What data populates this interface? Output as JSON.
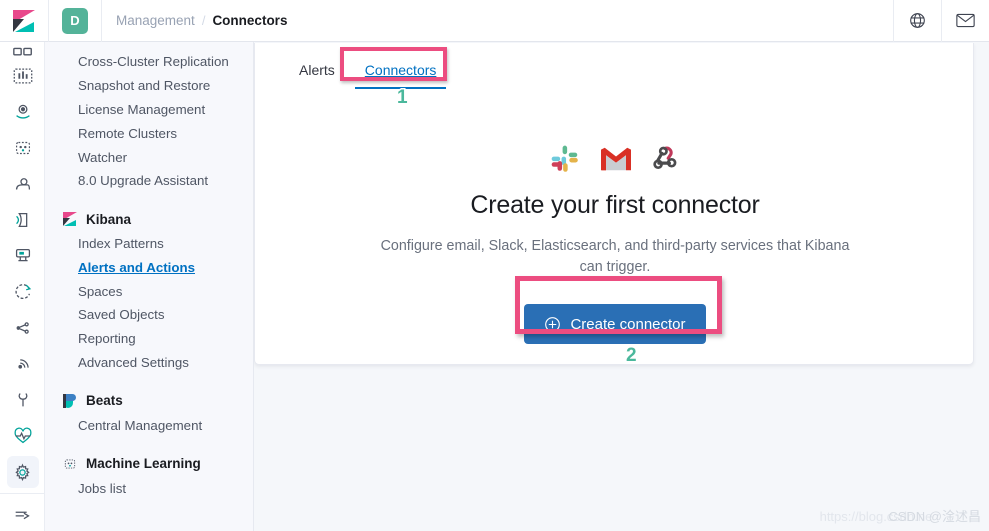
{
  "header": {
    "logo_name": "kibana-logo",
    "space_avatar": "D",
    "breadcrumb": {
      "parent": "Management",
      "separator": "/",
      "current": "Connectors"
    },
    "right_icons": [
      {
        "name": "help-icon",
        "label": "Help"
      },
      {
        "name": "mail-icon",
        "label": "Mail"
      }
    ]
  },
  "rail": {
    "items": [
      {
        "name": "rail-item-dashboard",
        "label": "Dashboard"
      },
      {
        "name": "rail-item-canvas",
        "label": "Canvas"
      },
      {
        "name": "rail-item-maps",
        "label": "Maps"
      },
      {
        "name": "rail-item-machine-learning",
        "label": "Machine Learning"
      },
      {
        "name": "rail-item-infrastructure",
        "label": "Infrastructure"
      },
      {
        "name": "rail-item-logs",
        "label": "Logs"
      },
      {
        "name": "rail-item-apm",
        "label": "APM"
      },
      {
        "name": "rail-item-uptime",
        "label": "Uptime"
      },
      {
        "name": "rail-item-siem",
        "label": "SIEM"
      },
      {
        "name": "rail-item-monitoring",
        "label": "Monitoring"
      },
      {
        "name": "rail-item-dev-tools",
        "label": "Dev Tools"
      },
      {
        "name": "rail-item-stack-monitoring",
        "label": "Stack Monitoring"
      },
      {
        "name": "rail-item-management",
        "label": "Management"
      },
      {
        "name": "rail-item-collapse",
        "label": "Collapse"
      }
    ]
  },
  "nav": {
    "elasticsearch_items": [
      "Cross-Cluster Replication",
      "Snapshot and Restore",
      "License Management",
      "Remote Clusters",
      "Watcher",
      "8.0 Upgrade Assistant"
    ],
    "groups": [
      {
        "title": "Kibana",
        "icon": "kibana-icon",
        "items": [
          {
            "label": "Index Patterns",
            "active": false
          },
          {
            "label": "Alerts and Actions",
            "active": true
          },
          {
            "label": "Spaces",
            "active": false
          },
          {
            "label": "Saved Objects",
            "active": false
          },
          {
            "label": "Reporting",
            "active": false
          },
          {
            "label": "Advanced Settings",
            "active": false
          }
        ]
      },
      {
        "title": "Beats",
        "icon": "beats-icon",
        "items": [
          {
            "label": "Central Management",
            "active": false
          }
        ]
      },
      {
        "title": "Machine Learning",
        "icon": "machine-learning-icon",
        "items": [
          {
            "label": "Jobs list",
            "active": false
          }
        ]
      }
    ]
  },
  "main": {
    "tabs": [
      {
        "label": "Alerts",
        "selected": false
      },
      {
        "label": "Connectors",
        "selected": true
      }
    ],
    "connector_logos": [
      {
        "name": "slack-icon",
        "label": "Slack"
      },
      {
        "name": "gmail-icon",
        "label": "Gmail"
      },
      {
        "name": "webhook-icon",
        "label": "Webhook"
      }
    ],
    "title": "Create your first connector",
    "description": "Configure email, Slack, Elasticsearch, and third-party services that Kibana can trigger.",
    "create_button": {
      "label": "Create connector",
      "icon": "plus-in-circle-icon"
    }
  },
  "annotations": {
    "marker_1": "1",
    "marker_2": "2",
    "highlight_color": "#ec4d80",
    "marker_color": "#4bb89c"
  },
  "watermark": {
    "url": "https://blog.csdn.ne",
    "tag": "CSDN @淦述昌"
  }
}
